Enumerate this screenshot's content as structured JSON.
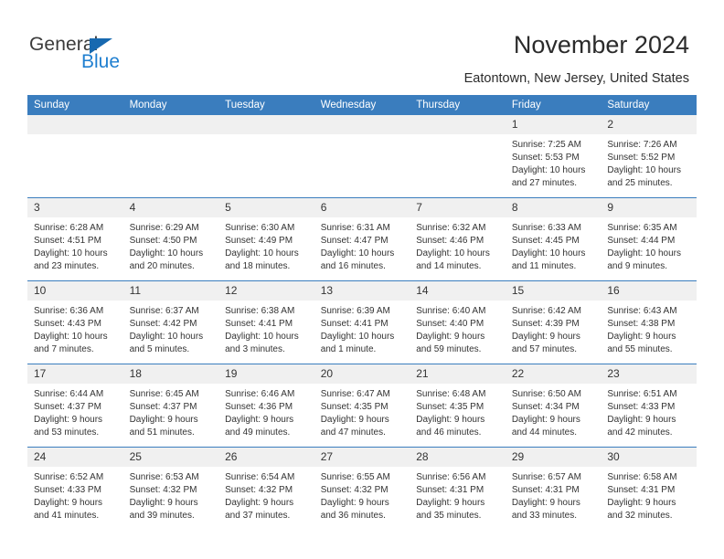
{
  "brand": {
    "name_part1": "General",
    "name_part2": "Blue",
    "triangle_color": "#1769b0",
    "blue_text_color": "#1f7fd0"
  },
  "header": {
    "title": "November 2024",
    "subtitle": "Eatontown, New Jersey, United States",
    "header_bg_color": "#3a7dbe",
    "daynum_bg_color": "#f0f0f0"
  },
  "weekday_headers": [
    "Sunday",
    "Monday",
    "Tuesday",
    "Wednesday",
    "Thursday",
    "Friday",
    "Saturday"
  ],
  "labels": {
    "sunrise": "Sunrise:",
    "sunset": "Sunset:",
    "daylight": "Daylight:"
  },
  "weeks": [
    [
      {
        "day": "",
        "sunrise": "",
        "sunset": "",
        "daylight_line1": "",
        "daylight_line2": ""
      },
      {
        "day": "",
        "sunrise": "",
        "sunset": "",
        "daylight_line1": "",
        "daylight_line2": ""
      },
      {
        "day": "",
        "sunrise": "",
        "sunset": "",
        "daylight_line1": "",
        "daylight_line2": ""
      },
      {
        "day": "",
        "sunrise": "",
        "sunset": "",
        "daylight_line1": "",
        "daylight_line2": ""
      },
      {
        "day": "",
        "sunrise": "",
        "sunset": "",
        "daylight_line1": "",
        "daylight_line2": ""
      },
      {
        "day": "1",
        "sunrise": "Sunrise: 7:25 AM",
        "sunset": "Sunset: 5:53 PM",
        "daylight_line1": "Daylight: 10 hours",
        "daylight_line2": "and 27 minutes."
      },
      {
        "day": "2",
        "sunrise": "Sunrise: 7:26 AM",
        "sunset": "Sunset: 5:52 PM",
        "daylight_line1": "Daylight: 10 hours",
        "daylight_line2": "and 25 minutes."
      }
    ],
    [
      {
        "day": "3",
        "sunrise": "Sunrise: 6:28 AM",
        "sunset": "Sunset: 4:51 PM",
        "daylight_line1": "Daylight: 10 hours",
        "daylight_line2": "and 23 minutes."
      },
      {
        "day": "4",
        "sunrise": "Sunrise: 6:29 AM",
        "sunset": "Sunset: 4:50 PM",
        "daylight_line1": "Daylight: 10 hours",
        "daylight_line2": "and 20 minutes."
      },
      {
        "day": "5",
        "sunrise": "Sunrise: 6:30 AM",
        "sunset": "Sunset: 4:49 PM",
        "daylight_line1": "Daylight: 10 hours",
        "daylight_line2": "and 18 minutes."
      },
      {
        "day": "6",
        "sunrise": "Sunrise: 6:31 AM",
        "sunset": "Sunset: 4:47 PM",
        "daylight_line1": "Daylight: 10 hours",
        "daylight_line2": "and 16 minutes."
      },
      {
        "day": "7",
        "sunrise": "Sunrise: 6:32 AM",
        "sunset": "Sunset: 4:46 PM",
        "daylight_line1": "Daylight: 10 hours",
        "daylight_line2": "and 14 minutes."
      },
      {
        "day": "8",
        "sunrise": "Sunrise: 6:33 AM",
        "sunset": "Sunset: 4:45 PM",
        "daylight_line1": "Daylight: 10 hours",
        "daylight_line2": "and 11 minutes."
      },
      {
        "day": "9",
        "sunrise": "Sunrise: 6:35 AM",
        "sunset": "Sunset: 4:44 PM",
        "daylight_line1": "Daylight: 10 hours",
        "daylight_line2": "and 9 minutes."
      }
    ],
    [
      {
        "day": "10",
        "sunrise": "Sunrise: 6:36 AM",
        "sunset": "Sunset: 4:43 PM",
        "daylight_line1": "Daylight: 10 hours",
        "daylight_line2": "and 7 minutes."
      },
      {
        "day": "11",
        "sunrise": "Sunrise: 6:37 AM",
        "sunset": "Sunset: 4:42 PM",
        "daylight_line1": "Daylight: 10 hours",
        "daylight_line2": "and 5 minutes."
      },
      {
        "day": "12",
        "sunrise": "Sunrise: 6:38 AM",
        "sunset": "Sunset: 4:41 PM",
        "daylight_line1": "Daylight: 10 hours",
        "daylight_line2": "and 3 minutes."
      },
      {
        "day": "13",
        "sunrise": "Sunrise: 6:39 AM",
        "sunset": "Sunset: 4:41 PM",
        "daylight_line1": "Daylight: 10 hours",
        "daylight_line2": "and 1 minute."
      },
      {
        "day": "14",
        "sunrise": "Sunrise: 6:40 AM",
        "sunset": "Sunset: 4:40 PM",
        "daylight_line1": "Daylight: 9 hours",
        "daylight_line2": "and 59 minutes."
      },
      {
        "day": "15",
        "sunrise": "Sunrise: 6:42 AM",
        "sunset": "Sunset: 4:39 PM",
        "daylight_line1": "Daylight: 9 hours",
        "daylight_line2": "and 57 minutes."
      },
      {
        "day": "16",
        "sunrise": "Sunrise: 6:43 AM",
        "sunset": "Sunset: 4:38 PM",
        "daylight_line1": "Daylight: 9 hours",
        "daylight_line2": "and 55 minutes."
      }
    ],
    [
      {
        "day": "17",
        "sunrise": "Sunrise: 6:44 AM",
        "sunset": "Sunset: 4:37 PM",
        "daylight_line1": "Daylight: 9 hours",
        "daylight_line2": "and 53 minutes."
      },
      {
        "day": "18",
        "sunrise": "Sunrise: 6:45 AM",
        "sunset": "Sunset: 4:37 PM",
        "daylight_line1": "Daylight: 9 hours",
        "daylight_line2": "and 51 minutes."
      },
      {
        "day": "19",
        "sunrise": "Sunrise: 6:46 AM",
        "sunset": "Sunset: 4:36 PM",
        "daylight_line1": "Daylight: 9 hours",
        "daylight_line2": "and 49 minutes."
      },
      {
        "day": "20",
        "sunrise": "Sunrise: 6:47 AM",
        "sunset": "Sunset: 4:35 PM",
        "daylight_line1": "Daylight: 9 hours",
        "daylight_line2": "and 47 minutes."
      },
      {
        "day": "21",
        "sunrise": "Sunrise: 6:48 AM",
        "sunset": "Sunset: 4:35 PM",
        "daylight_line1": "Daylight: 9 hours",
        "daylight_line2": "and 46 minutes."
      },
      {
        "day": "22",
        "sunrise": "Sunrise: 6:50 AM",
        "sunset": "Sunset: 4:34 PM",
        "daylight_line1": "Daylight: 9 hours",
        "daylight_line2": "and 44 minutes."
      },
      {
        "day": "23",
        "sunrise": "Sunrise: 6:51 AM",
        "sunset": "Sunset: 4:33 PM",
        "daylight_line1": "Daylight: 9 hours",
        "daylight_line2": "and 42 minutes."
      }
    ],
    [
      {
        "day": "24",
        "sunrise": "Sunrise: 6:52 AM",
        "sunset": "Sunset: 4:33 PM",
        "daylight_line1": "Daylight: 9 hours",
        "daylight_line2": "and 41 minutes."
      },
      {
        "day": "25",
        "sunrise": "Sunrise: 6:53 AM",
        "sunset": "Sunset: 4:32 PM",
        "daylight_line1": "Daylight: 9 hours",
        "daylight_line2": "and 39 minutes."
      },
      {
        "day": "26",
        "sunrise": "Sunrise: 6:54 AM",
        "sunset": "Sunset: 4:32 PM",
        "daylight_line1": "Daylight: 9 hours",
        "daylight_line2": "and 37 minutes."
      },
      {
        "day": "27",
        "sunrise": "Sunrise: 6:55 AM",
        "sunset": "Sunset: 4:32 PM",
        "daylight_line1": "Daylight: 9 hours",
        "daylight_line2": "and 36 minutes."
      },
      {
        "day": "28",
        "sunrise": "Sunrise: 6:56 AM",
        "sunset": "Sunset: 4:31 PM",
        "daylight_line1": "Daylight: 9 hours",
        "daylight_line2": "and 35 minutes."
      },
      {
        "day": "29",
        "sunrise": "Sunrise: 6:57 AM",
        "sunset": "Sunset: 4:31 PM",
        "daylight_line1": "Daylight: 9 hours",
        "daylight_line2": "and 33 minutes."
      },
      {
        "day": "30",
        "sunrise": "Sunrise: 6:58 AM",
        "sunset": "Sunset: 4:31 PM",
        "daylight_line1": "Daylight: 9 hours",
        "daylight_line2": "and 32 minutes."
      }
    ]
  ]
}
